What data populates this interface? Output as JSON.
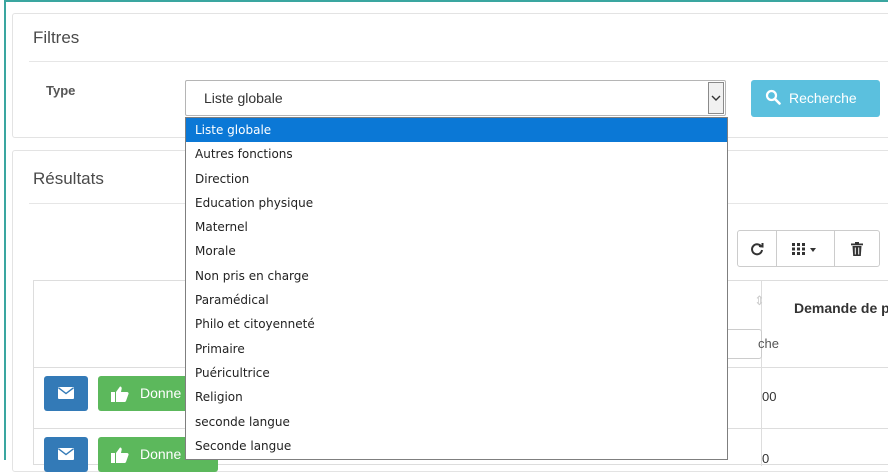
{
  "filters": {
    "title": "Filtres",
    "type_label": "Type",
    "selected_type": "Liste globale",
    "search_button": "Recherche",
    "options": [
      "Liste globale",
      "Autres fonctions",
      "Direction",
      "Education physique",
      "Maternel",
      "Morale",
      "Non pris en charge",
      "Paramédical",
      "Philo et citoyenneté",
      "Primaire",
      "Puéricultrice",
      "Religion",
      "seconde langue",
      "Seconde langue"
    ]
  },
  "results": {
    "title": "Résultats",
    "column_demande": "Demande de pr",
    "filter_partial": "che",
    "rows": [
      {
        "action_label": "Donne",
        "value": "00"
      },
      {
        "action_label": "Donne",
        "value": "0"
      }
    ]
  },
  "icons": {
    "search": "search-icon",
    "refresh": "refresh-icon",
    "columns": "grid-icon",
    "trash": "trash-icon",
    "mail": "envelope-icon",
    "thumbs": "thumbs-up-icon"
  },
  "colors": {
    "search_button": "#5bc0de",
    "mail_button": "#337ab7",
    "donner_button": "#5cb85c",
    "selected_option": "#0b78d6"
  }
}
